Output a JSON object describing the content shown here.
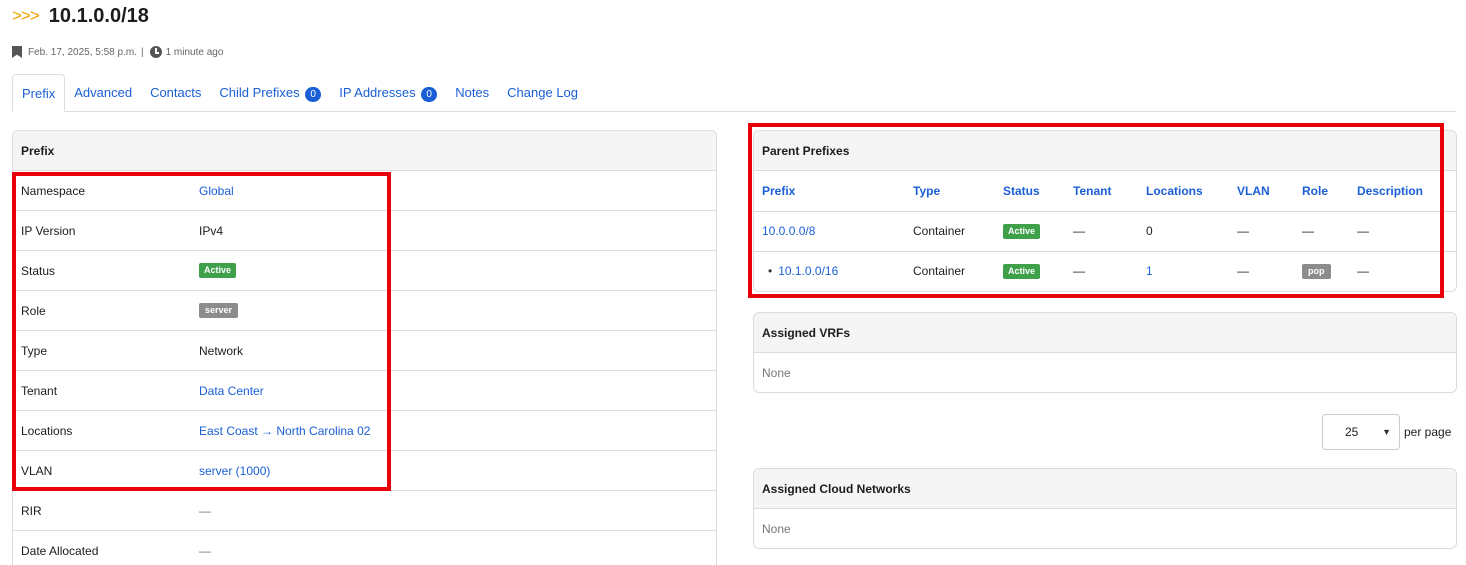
{
  "header": {
    "breadcrumb_arrows": ">>>",
    "title": "10.1.0.0/18",
    "created": "Feb. 17, 2025, 5:58 p.m.",
    "separator": "|",
    "updated": "1 minute ago"
  },
  "tabs": [
    {
      "label": "Prefix",
      "active": true
    },
    {
      "label": "Advanced"
    },
    {
      "label": "Contacts"
    },
    {
      "label": "Child Prefixes",
      "count": "0"
    },
    {
      "label": "IP Addresses",
      "count": "0"
    },
    {
      "label": "Notes"
    },
    {
      "label": "Change Log"
    }
  ],
  "prefix_panel": {
    "heading": "Prefix",
    "rows": [
      {
        "label": "Namespace",
        "value": "Global"
      },
      {
        "label": "IP Version",
        "value": "IPv4"
      },
      {
        "label": "Status",
        "value": "Active"
      },
      {
        "label": "Role",
        "value": "server"
      },
      {
        "label": "Type",
        "value": "Network"
      },
      {
        "label": "Tenant",
        "value": "Data Center"
      },
      {
        "label": "Locations",
        "value": "East Coast → North Carolina 02"
      },
      {
        "label": "VLAN",
        "value": "server (1000)"
      },
      {
        "label": "RIR",
        "value": "—"
      },
      {
        "label": "Date Allocated",
        "value": "—"
      }
    ]
  },
  "parent_prefixes": {
    "heading": "Parent Prefixes",
    "columns": [
      "Prefix",
      "Type",
      "Status",
      "Tenant",
      "Locations",
      "VLAN",
      "Role",
      "Description"
    ],
    "rows": [
      {
        "prefix": "10.0.0.0/8",
        "type": "Container",
        "status": "Active",
        "tenant": "—",
        "locations": "0",
        "vlan": "—",
        "role": "—",
        "description": "—"
      },
      {
        "bullet": "•",
        "prefix": "10.1.0.0/16",
        "type": "Container",
        "status": "Active",
        "tenant": "—",
        "locations": "1",
        "vlan": "—",
        "role": "pop",
        "description": "—"
      }
    ]
  },
  "assigned_vrfs": {
    "heading": "Assigned VRFs",
    "body": "None"
  },
  "pagination": {
    "per_page_value": "25",
    "per_page_label": "per page"
  },
  "assigned_cloud_networks": {
    "heading": "Assigned Cloud Networks",
    "body": "None"
  },
  "colors": {
    "accent": "#1a5fd6",
    "success": "#3fa04a",
    "highlight": "#e8000b",
    "arrows": "#f2a200"
  }
}
